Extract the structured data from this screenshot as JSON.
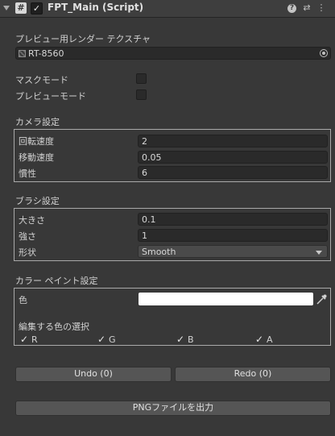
{
  "header": {
    "script_icon": "#",
    "title": "FPT_Main (Script)",
    "enabled_check": "✓",
    "help_icon": "?",
    "preset_icon": "⇄",
    "menu_icon": "⋮"
  },
  "preview": {
    "label": "プレビュー用レンダー テクスチャ",
    "texture_value": "RT-8560",
    "texture_icon": "render-texture-icon"
  },
  "toggles": {
    "mask_mode_label": "マスクモード",
    "preview_mode_label": "プレビューモード"
  },
  "camera": {
    "section_label": "カメラ設定",
    "rotation_label": "回転速度",
    "rotation_value": "2",
    "move_label": "移動速度",
    "move_value": "0.05",
    "inertia_label": "慣性",
    "inertia_value": "6"
  },
  "brush": {
    "section_label": "ブラシ設定",
    "size_label": "大きさ",
    "size_value": "0.1",
    "strength_label": "強さ",
    "strength_value": "1",
    "shape_label": "形状",
    "shape_value": "Smooth"
  },
  "color_paint": {
    "section_label": "カラー ペイント設定",
    "color_label": "色",
    "color_value": "#ffffff",
    "channel_select_label": "編集する色の選択",
    "check_glyph": "✓",
    "channels": [
      "R",
      "G",
      "B",
      "A"
    ]
  },
  "actions": {
    "undo_label": "Undo (0)",
    "redo_label": "Redo (0)",
    "export_label": "PNGファイルを出力"
  }
}
